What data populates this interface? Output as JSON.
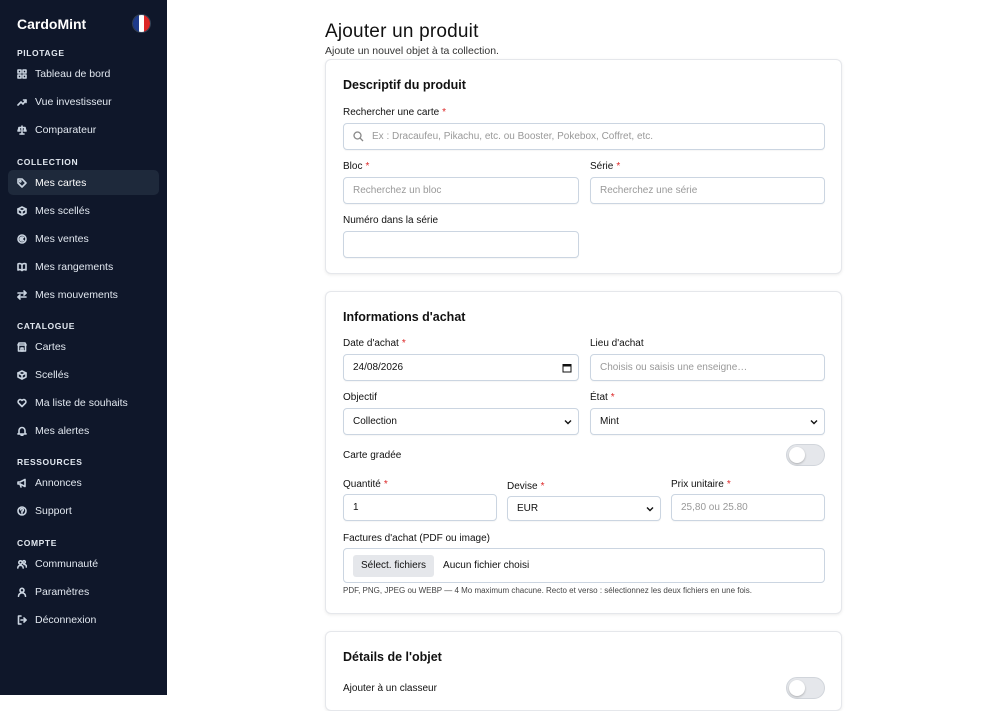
{
  "app": {
    "name": "CardoMint"
  },
  "flag_colors": [
    "#1e3a8a",
    "#ffffff",
    "#dc2626"
  ],
  "sidebar": {
    "sections": [
      {
        "title": "PILOTAGE",
        "items": [
          {
            "label": "Tableau de bord",
            "icon": "dashboard-icon"
          },
          {
            "label": "Vue investisseur",
            "icon": "trending-up-icon"
          },
          {
            "label": "Comparateur",
            "icon": "scale-icon"
          }
        ]
      },
      {
        "title": "COLLECTION",
        "items": [
          {
            "label": "Mes cartes",
            "icon": "tag-icon",
            "active": true
          },
          {
            "label": "Mes scellés",
            "icon": "package-icon"
          },
          {
            "label": "Mes ventes",
            "icon": "euro-icon"
          },
          {
            "label": "Mes rangements",
            "icon": "book-icon"
          },
          {
            "label": "Mes mouvements",
            "icon": "arrows-icon"
          }
        ]
      },
      {
        "title": "CATALOGUE",
        "items": [
          {
            "label": "Cartes",
            "icon": "store-icon"
          },
          {
            "label": "Scellés",
            "icon": "package-icon"
          },
          {
            "label": "Ma liste de souhaits",
            "icon": "heart-icon"
          },
          {
            "label": "Mes alertes",
            "icon": "bell-icon"
          }
        ]
      },
      {
        "title": "RESSOURCES",
        "items": [
          {
            "label": "Annonces",
            "icon": "megaphone-icon"
          },
          {
            "label": "Support",
            "icon": "help-icon"
          }
        ]
      },
      {
        "title": "COMPTE",
        "items": [
          {
            "label": "Communauté",
            "icon": "users-icon"
          },
          {
            "label": "Paramètres",
            "icon": "user-icon"
          },
          {
            "label": "Déconnexion",
            "icon": "logout-icon"
          }
        ]
      }
    ]
  },
  "page": {
    "title": "Ajouter un produit",
    "subtitle": "Ajoute un nouvel objet à ta collection."
  },
  "descriptif": {
    "title": "Descriptif du produit",
    "search_label": "Rechercher une carte",
    "search_placeholder": "Ex : Dracaufeu, Pikachu, etc. ou Booster, Pokebox, Coffret, etc.",
    "bloc_label": "Bloc",
    "bloc_placeholder": "Recherchez un bloc",
    "serie_label": "Série",
    "serie_placeholder": "Recherchez une série",
    "numero_label": "Numéro dans la série",
    "numero_value": ""
  },
  "achat": {
    "title": "Informations d'achat",
    "date_label": "Date d'achat",
    "date_value": "24/08/2026",
    "lieu_label": "Lieu d'achat",
    "lieu_placeholder": "Choisis ou saisis une enseigne…",
    "objectif_label": "Objectif",
    "objectif_value": "Collection",
    "etat_label": "État",
    "etat_value": "Mint",
    "gradee_label": "Carte gradée",
    "gradee_on": false,
    "quantite_label": "Quantité",
    "quantite_value": "1",
    "devise_label": "Devise",
    "devise_value": "EUR",
    "prix_label": "Prix unitaire",
    "prix_placeholder": "25,80 ou 25.80",
    "factures_label": "Factures d'achat (PDF ou image)",
    "file_button": "Sélect. fichiers",
    "file_status": "Aucun fichier choisi",
    "file_hint": "PDF, PNG, JPEG ou WEBP — 4 Mo maximum chacune. Recto et verso : sélectionnez les deux fichiers en une fois."
  },
  "details": {
    "title": "Détails de l'objet",
    "classeur_label": "Ajouter à un classeur",
    "classeur_on": false
  }
}
